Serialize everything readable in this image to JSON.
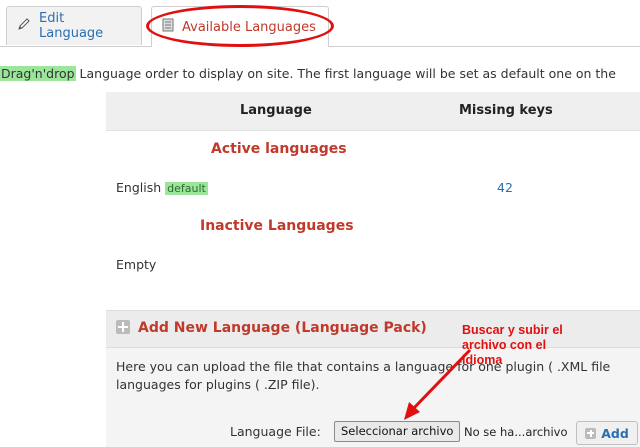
{
  "tabs": [
    {
      "label": "Edit Language",
      "icon": "pencil-icon",
      "active": false
    },
    {
      "label": "Available Languages",
      "icon": "document-icon",
      "active": true
    }
  ],
  "info": {
    "highlight": "Drag'n'drop",
    "text": " Language order to display on site. The first language will be set as default one on the"
  },
  "table": {
    "columns": [
      "Language",
      "Missing keys"
    ],
    "active_title": "Active languages",
    "active_rows": [
      {
        "language": "English",
        "badge": "default",
        "missing": "42"
      }
    ],
    "inactive_title": "Inactive Languages",
    "inactive_empty": "Empty"
  },
  "add_panel": {
    "title": "Add New Language (Language Pack)",
    "desc_line1": "Here you can upload the file that contains a language for one plugin ( .XML file",
    "desc_line2": "languages for plugins ( .ZIP file).",
    "file_label": "Language File:",
    "file_button": "Seleccionar archivo",
    "file_status": "No se ha...archivo",
    "add_button": "Add"
  },
  "annotation": {
    "line1": "Buscar y subir el",
    "line2": "archivo con el",
    "line3": "idioma",
    "color": "#e01010"
  },
  "colors": {
    "accent_red": "#c0392b",
    "link_blue": "#2a6fb0",
    "highlight_green": "#9be69b"
  }
}
